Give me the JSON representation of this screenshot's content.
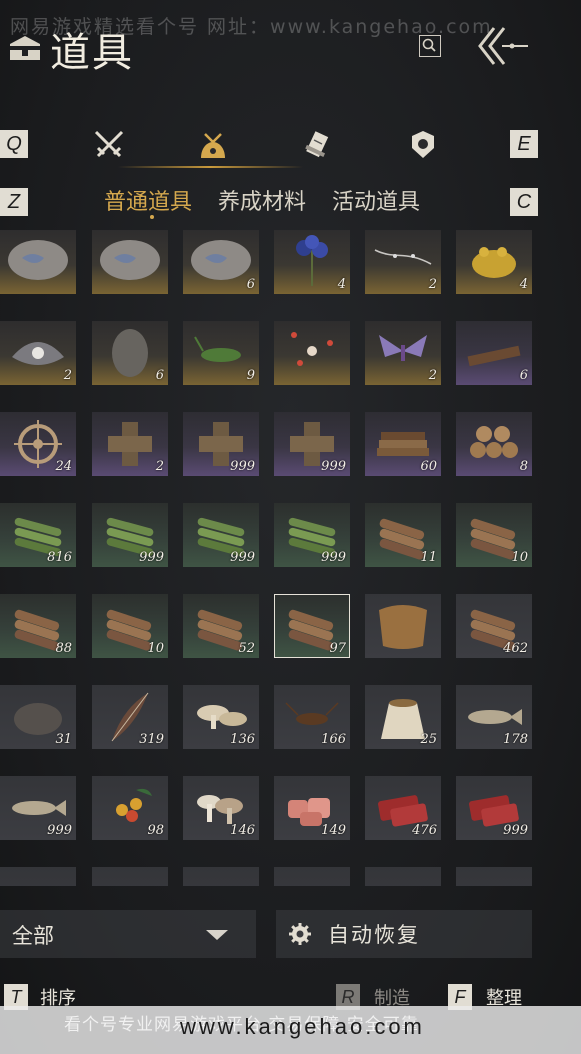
{
  "watermark": {
    "top": "网易游戏精选看个号   网址：www.kangehao.com",
    "bottom": "看个号专业网易游戏平台   交易保障 安全可靠",
    "url": "www.kangehao.com"
  },
  "header": {
    "title": "道具",
    "title_icon": "chest-icon",
    "search_icon": "search-icon",
    "back_icon": "double-chevron-back-icon"
  },
  "categories": {
    "prev_key": "Q",
    "next_key": "E",
    "items": [
      {
        "icon": "crossed-swords-icon"
      },
      {
        "icon": "pouch-icon",
        "active": true
      },
      {
        "icon": "scroll-icon"
      },
      {
        "icon": "medal-icon"
      }
    ]
  },
  "subtabs": {
    "prev_key": "Z",
    "next_key": "C",
    "items": [
      {
        "label": "普通道具",
        "active": true
      },
      {
        "label": "养成材料",
        "active": false
      },
      {
        "label": "活动道具",
        "active": false
      }
    ]
  },
  "items": [
    {
      "icon": "stone-fossil-icon",
      "count": "",
      "rarity": "gold"
    },
    {
      "icon": "stone-fossil-icon",
      "count": "",
      "rarity": "gold"
    },
    {
      "icon": "stone-fossil-icon",
      "count": "6",
      "rarity": "gold"
    },
    {
      "icon": "blue-flower-icon",
      "count": "4",
      "rarity": "gold"
    },
    {
      "icon": "white-vine-icon",
      "count": "2",
      "rarity": "gold"
    },
    {
      "icon": "golden-toad-icon",
      "count": "4",
      "rarity": "gold"
    },
    {
      "icon": "pearl-shell-icon",
      "count": "2",
      "rarity": "gold"
    },
    {
      "icon": "gray-stone-icon",
      "count": "6",
      "rarity": "gold"
    },
    {
      "icon": "grasshopper-icon",
      "count": "9",
      "rarity": "gold"
    },
    {
      "icon": "fireflies-icon",
      "count": "",
      "rarity": "gold"
    },
    {
      "icon": "purple-moth-icon",
      "count": "2",
      "rarity": "gold"
    },
    {
      "icon": "wood-board-icon",
      "count": "6",
      "rarity": "purple"
    },
    {
      "icon": "ship-wheel-icon",
      "count": "24",
      "rarity": "purple"
    },
    {
      "icon": "wood-cross-icon",
      "count": "2",
      "rarity": "purple"
    },
    {
      "icon": "wood-cross-icon",
      "count": "999",
      "rarity": "purple"
    },
    {
      "icon": "wood-cross-icon",
      "count": "999",
      "rarity": "purple"
    },
    {
      "icon": "plank-stack-icon",
      "count": "60",
      "rarity": "purple"
    },
    {
      "icon": "log-pile-icon",
      "count": "8",
      "rarity": "purple"
    },
    {
      "icon": "bamboo-bundle-icon",
      "count": "816",
      "rarity": "green"
    },
    {
      "icon": "bamboo-bundle-icon",
      "count": "999",
      "rarity": "green"
    },
    {
      "icon": "bamboo-bundle-icon",
      "count": "999",
      "rarity": "green"
    },
    {
      "icon": "bamboo-bundle-icon",
      "count": "999",
      "rarity": "green"
    },
    {
      "icon": "log-bundle-icon",
      "count": "11",
      "rarity": "green"
    },
    {
      "icon": "log-bundle-icon",
      "count": "10",
      "rarity": "green"
    },
    {
      "icon": "log-bundle-icon",
      "count": "88",
      "rarity": "green"
    },
    {
      "icon": "log-bundle-icon",
      "count": "10",
      "rarity": "green"
    },
    {
      "icon": "log-bundle-icon",
      "count": "52",
      "rarity": "green"
    },
    {
      "icon": "log-bundle-icon",
      "count": "97",
      "rarity": "green",
      "selected": true
    },
    {
      "icon": "fur-pelt-icon",
      "count": "",
      "rarity": "plain"
    },
    {
      "icon": "log-bundle-icon",
      "count": "462",
      "rarity": "plain"
    },
    {
      "icon": "rock-icon",
      "count": "31",
      "rarity": "plain"
    },
    {
      "icon": "feather-icon",
      "count": "319",
      "rarity": "plain"
    },
    {
      "icon": "mushroom-icon",
      "count": "136",
      "rarity": "plain"
    },
    {
      "icon": "cricket-icon",
      "count": "166",
      "rarity": "plain"
    },
    {
      "icon": "grain-sack-icon",
      "count": "25",
      "rarity": "plain"
    },
    {
      "icon": "fish-icon",
      "count": "178",
      "rarity": "plain"
    },
    {
      "icon": "fish-icon",
      "count": "999",
      "rarity": "plain"
    },
    {
      "icon": "berries-icon",
      "count": "98",
      "rarity": "plain"
    },
    {
      "icon": "mushroom-cluster-icon",
      "count": "146",
      "rarity": "plain"
    },
    {
      "icon": "raw-meat-icon",
      "count": "149",
      "rarity": "plain"
    },
    {
      "icon": "red-meat-icon",
      "count": "476",
      "rarity": "plain"
    },
    {
      "icon": "red-meat-icon",
      "count": "999",
      "rarity": "plain"
    },
    {
      "icon": "item-icon",
      "count": "",
      "rarity": "plain"
    },
    {
      "icon": "item-icon",
      "count": "",
      "rarity": "plain"
    },
    {
      "icon": "item-icon",
      "count": "",
      "rarity": "plain"
    },
    {
      "icon": "item-icon",
      "count": "",
      "rarity": "plain"
    },
    {
      "icon": "item-icon",
      "count": "",
      "rarity": "plain"
    },
    {
      "icon": "item-icon",
      "count": "",
      "rarity": "plain"
    }
  ],
  "filter": {
    "label": "全部",
    "chevron_icon": "chevron-down-icon"
  },
  "auto_restore": {
    "label": "自动恢复",
    "icon": "gear-icon"
  },
  "bottom_actions": [
    {
      "key": "T",
      "label": "排序",
      "enabled": true
    },
    {
      "key": "R",
      "label": "制造",
      "enabled": false
    },
    {
      "key": "F",
      "label": "整理",
      "enabled": true
    }
  ]
}
